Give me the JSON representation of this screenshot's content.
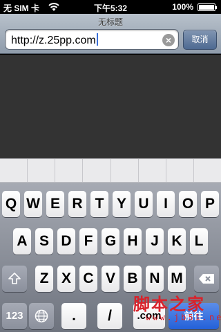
{
  "status_bar": {
    "carrier": "无 SIM 卡",
    "time": "下午5:32",
    "battery_percent": "100%",
    "wifi_icon": "wifi-icon",
    "battery_icon": "battery-icon"
  },
  "browser": {
    "page_title": "无标题",
    "url": "http://z.25pp.com",
    "clear_icon": "clear-circle-icon",
    "cancel_label": "取消"
  },
  "keyboard": {
    "row1": [
      "Q",
      "W",
      "E",
      "R",
      "T",
      "Y",
      "U",
      "I",
      "O",
      "P"
    ],
    "row2": [
      "A",
      "S",
      "D",
      "F",
      "G",
      "H",
      "J",
      "K",
      "L"
    ],
    "row3": [
      "Z",
      "X",
      "C",
      "V",
      "B",
      "N",
      "M"
    ],
    "shift_icon": "shift-arrow-icon",
    "delete_icon": "backspace-icon",
    "numbers_label": "123",
    "globe_icon": "globe-icon",
    "period_label": ".",
    "slash_label": "/",
    "dotcom_label": ".com",
    "go_label": "前往"
  },
  "watermark": {
    "main": "脚本之家",
    "sub": "www.jb51.net"
  }
}
